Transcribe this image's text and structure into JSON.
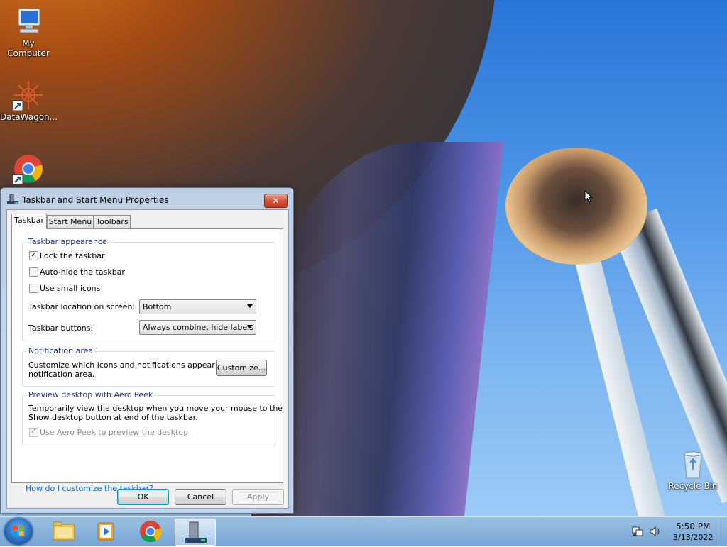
{
  "desktop": {
    "icons": [
      {
        "label": "My Computer"
      },
      {
        "label": "DataWagon..."
      },
      {
        "label": ""
      },
      {
        "label": "Recycle Bin"
      }
    ]
  },
  "dialog": {
    "title": "Taskbar and Start Menu Properties",
    "close_symbol": "✕",
    "tabs": [
      "Taskbar",
      "Start Menu",
      "Toolbars"
    ],
    "appearance": {
      "title": "Taskbar appearance",
      "lock_label": "Lock the taskbar",
      "lock_checked": true,
      "autohide_label": "Auto-hide the taskbar",
      "autohide_checked": false,
      "small_icons_label": "Use small icons",
      "small_icons_checked": false,
      "location_label": "Taskbar location on screen:",
      "location_value": "Bottom",
      "buttons_label": "Taskbar buttons:",
      "buttons_value": "Always combine, hide labels"
    },
    "notification": {
      "title": "Notification area",
      "text_line1": "Customize which icons and notifications appear in the",
      "text_line2": "notification area.",
      "customize_button": "Customize..."
    },
    "aero_peek": {
      "title": "Preview desktop with Aero Peek",
      "text_line1": "Temporarily view the desktop when you move your mouse to the",
      "text_line2": "Show desktop button at end of the taskbar.",
      "checkbox_label": "Use Aero Peek to preview the desktop",
      "checked": true,
      "disabled": true
    },
    "help_link": "How do I customize the taskbar?",
    "buttons": {
      "ok": "OK",
      "cancel": "Cancel",
      "apply": "Apply"
    }
  },
  "taskbar": {
    "items": [
      "start-orb",
      "file-explorer-icon",
      "media-player-icon",
      "chrome-icon",
      "taskbar-properties-icon"
    ],
    "clock_time": "5:50 PM",
    "clock_date": "3/13/2022"
  },
  "colors": {
    "link": "#0066cc",
    "group_title": "#1e3287",
    "close_red": "#c43b22"
  }
}
